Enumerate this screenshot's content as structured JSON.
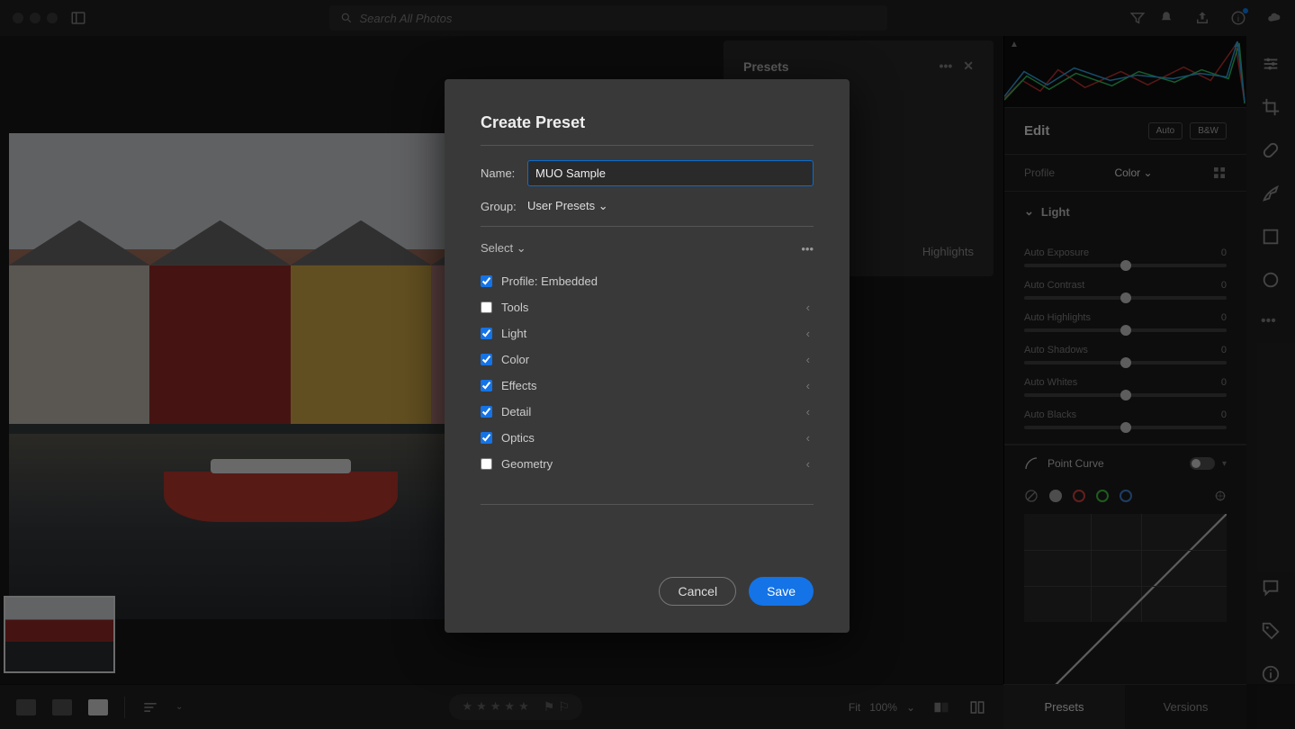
{
  "topbar": {
    "search_placeholder": "Search All Photos"
  },
  "presets_panel": {
    "title": "Presets",
    "visible_item": "Highlights"
  },
  "edit_panel": {
    "title": "Edit",
    "auto": "Auto",
    "bw": "B&W",
    "profile_label": "Profile",
    "profile_value": "Color",
    "light_section": "Light",
    "sliders": [
      {
        "name": "Auto Exposure",
        "value": "0"
      },
      {
        "name": "Auto Contrast",
        "value": "0"
      },
      {
        "name": "Auto Highlights",
        "value": "0"
      },
      {
        "name": "Auto Shadows",
        "value": "0"
      },
      {
        "name": "Auto Whites",
        "value": "0"
      },
      {
        "name": "Auto Blacks",
        "value": "0"
      }
    ],
    "point_curve": "Point Curve"
  },
  "bottom_tabs": {
    "presets": "Presets",
    "versions": "Versions"
  },
  "bottombar": {
    "fit": "Fit",
    "zoom": "100%"
  },
  "modal": {
    "title": "Create Preset",
    "name_label": "Name:",
    "name_value": "MUO Sample",
    "group_label": "Group:",
    "group_value": "User Presets",
    "select": "Select",
    "options": [
      {
        "label": "Profile: Embedded",
        "checked": true,
        "chev": false
      },
      {
        "label": "Tools",
        "checked": false,
        "chev": true
      },
      {
        "label": "Light",
        "checked": true,
        "chev": true
      },
      {
        "label": "Color",
        "checked": true,
        "chev": true
      },
      {
        "label": "Effects",
        "checked": true,
        "chev": true
      },
      {
        "label": "Detail",
        "checked": true,
        "chev": true
      },
      {
        "label": "Optics",
        "checked": true,
        "chev": true
      },
      {
        "label": "Geometry",
        "checked": false,
        "chev": true
      }
    ],
    "cancel": "Cancel",
    "save": "Save"
  }
}
